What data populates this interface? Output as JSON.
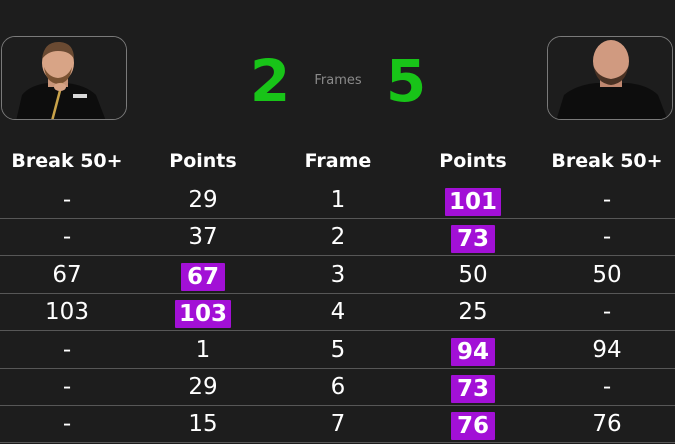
{
  "match": {
    "left_score": "2",
    "right_score": "5",
    "frames_label": "Frames"
  },
  "headers": {
    "left_break": "Break 50+",
    "left_points": "Points",
    "frame": "Frame",
    "right_points": "Points",
    "right_break": "Break 50+"
  },
  "rows": [
    {
      "left_break": "-",
      "left_points": "29",
      "frame": "1",
      "right_points": "101",
      "right_break": "-",
      "winner": "right"
    },
    {
      "left_break": "-",
      "left_points": "37",
      "frame": "2",
      "right_points": "73",
      "right_break": "-",
      "winner": "right"
    },
    {
      "left_break": "67",
      "left_points": "67",
      "frame": "3",
      "right_points": "50",
      "right_break": "50",
      "winner": "left"
    },
    {
      "left_break": "103",
      "left_points": "103",
      "frame": "4",
      "right_points": "25",
      "right_break": "-",
      "winner": "left"
    },
    {
      "left_break": "-",
      "left_points": "1",
      "frame": "5",
      "right_points": "94",
      "right_break": "94",
      "winner": "right"
    },
    {
      "left_break": "-",
      "left_points": "29",
      "frame": "6",
      "right_points": "73",
      "right_break": "-",
      "winner": "right"
    },
    {
      "left_break": "-",
      "left_points": "15",
      "frame": "7",
      "right_points": "76",
      "right_break": "76",
      "winner": "right"
    }
  ],
  "colors": {
    "background": "#1d1d1d",
    "score": "#18c418",
    "winner_highlight": "#a210d6",
    "divider": "#575757"
  }
}
